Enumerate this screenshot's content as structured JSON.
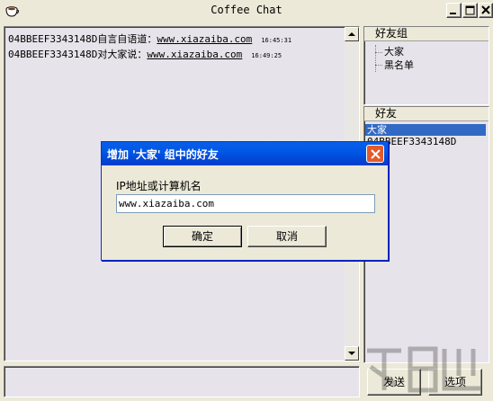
{
  "window": {
    "title": "Coffee Chat"
  },
  "chat": {
    "messages": [
      {
        "sender": "04BBEEF3343148D",
        "verb": "自言自语道：",
        "text": "www.xiazaiba.com",
        "time": "16:45:31"
      },
      {
        "sender": "04BBEEF3343148D",
        "verb": "对大家说：",
        "text": "www.xiazaiba.com",
        "time": "16:49:25"
      }
    ],
    "input_value": ""
  },
  "groups_panel": {
    "header": "好友组",
    "items": [
      "大家",
      "黑名单"
    ]
  },
  "friends_panel": {
    "header": "好友",
    "items": [
      "大家",
      "04BBEEF3343148D"
    ],
    "selected_index": 0
  },
  "buttons": {
    "send": "发送",
    "options": "选项"
  },
  "dialog": {
    "title": "增加 '大家' 组中的好友",
    "label": "IP地址或计算机名",
    "input_value": "www.xiazaiba.com",
    "ok": "确定",
    "cancel": "取消"
  },
  "colors": {
    "selection": "#316ac5",
    "dialog_title": "#0058e6",
    "dialog_close": "#e55a2b",
    "window_bg": "#ece9d8"
  },
  "icons": {
    "app": "coffee-cup-icon",
    "minimize": "minimize-icon",
    "maximize": "maximize-icon",
    "close": "close-icon"
  }
}
